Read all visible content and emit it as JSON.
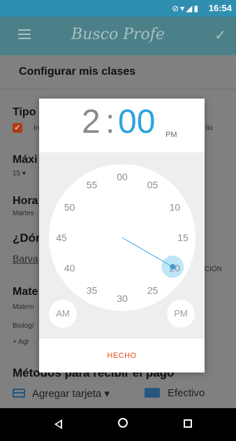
{
  "status_bar": {
    "time": "16:54",
    "icons": "⊘▾◢▮"
  },
  "app_bar": {
    "title": "Busco Profe",
    "confirm_icon": "check-icon"
  },
  "section": {
    "title": "Configurar mis clases"
  },
  "background": {
    "tipo_label": "Tipo",
    "tipo_opt": "In",
    "tipo_opt_right": "lio",
    "maxi_label": "Máxi",
    "maxi_value": "15 ▾",
    "hora_label": "Hora",
    "hora_value": "Martes",
    "donde_label": "¿Dón",
    "donde_value": "Barva",
    "donde_value_right": "CIÓN",
    "mate_label": "Mate",
    "mate_value": "Matem",
    "bio_label": "Biologí",
    "add_label": "+ Agr",
    "payment_title": "Métodos para recibir el pago",
    "add_card": "Agregar tarjeta ▾",
    "cash": "Efectivo"
  },
  "time_picker": {
    "hour": "2",
    "colon": ":",
    "minute": "00",
    "ampm": "PM",
    "minute_labels": [
      "00",
      "05",
      "10",
      "15",
      "20",
      "25",
      "30",
      "35",
      "40",
      "45",
      "50",
      "55"
    ],
    "selected_minute": 20,
    "am_label": "AM",
    "pm_label": "PM",
    "done_label": "HECHO"
  },
  "colors": {
    "accent": "#2aa4de",
    "selector": "#bfe6f7",
    "done": "#e64a19"
  }
}
